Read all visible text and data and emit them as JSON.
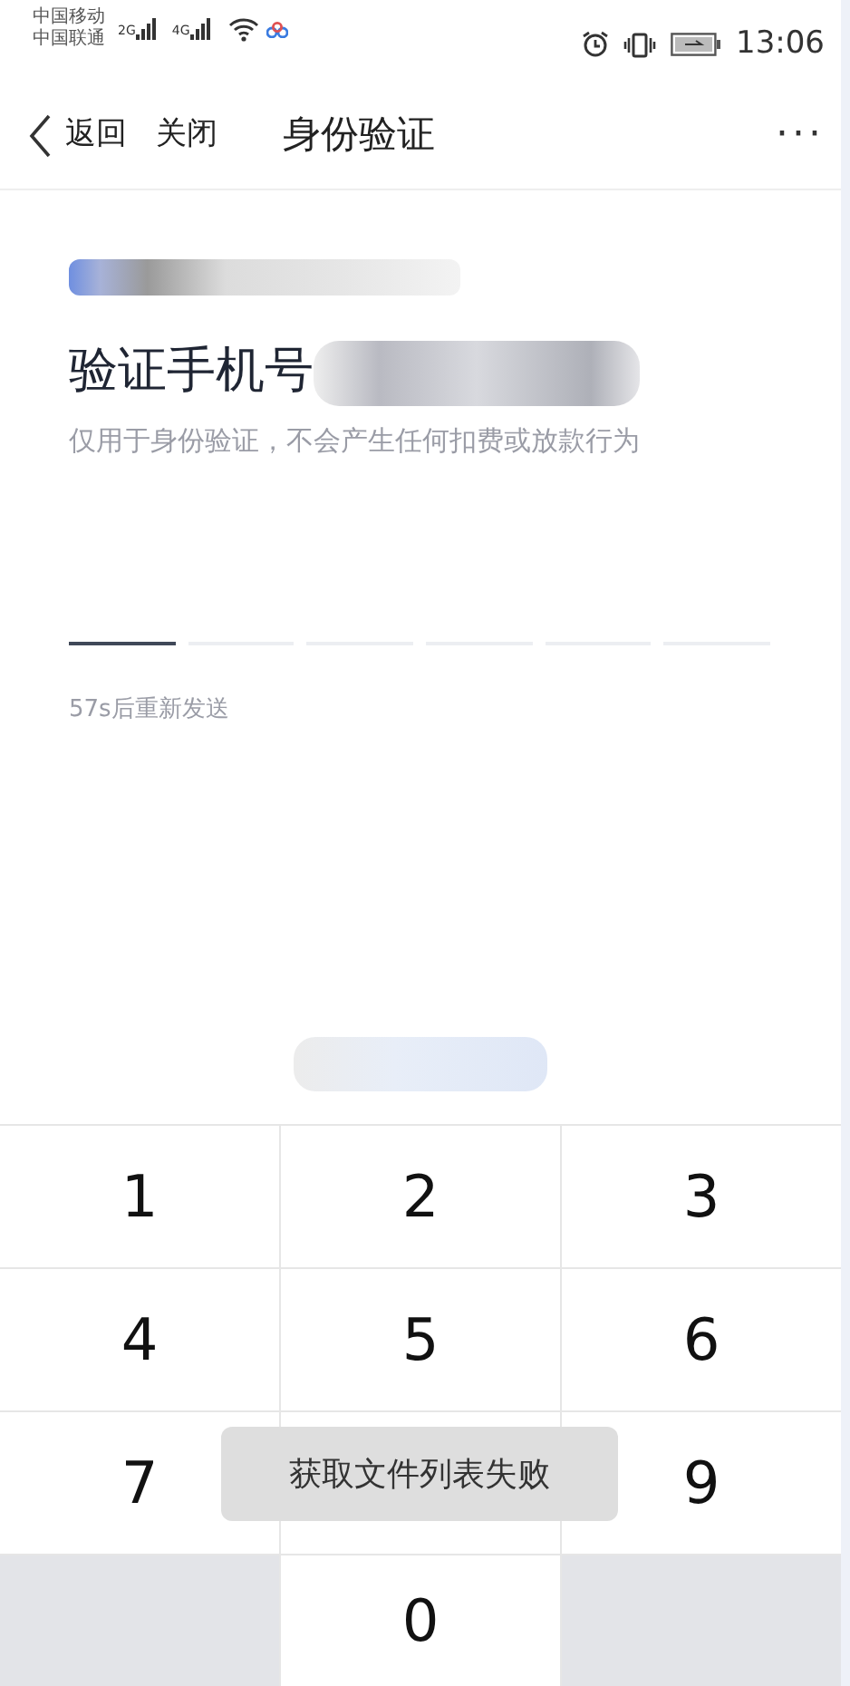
{
  "status_bar": {
    "carriers": [
      "中国移动",
      "中国联通"
    ],
    "networks": [
      "2G",
      "4G"
    ],
    "time": "13:06"
  },
  "nav": {
    "back": "返回",
    "close": "关闭",
    "title": "身份验证",
    "more": "···"
  },
  "heading": "验证手机号",
  "subtitle": "仅用于身份验证，不会产生任何扣费或放款行为",
  "code_cells": [
    {
      "selected": true
    },
    {
      "selected": false
    },
    {
      "selected": false
    },
    {
      "selected": false
    },
    {
      "selected": false
    },
    {
      "selected": false
    }
  ],
  "resend": "57s后重新发送",
  "keypad": [
    {
      "kind": "digit",
      "label": "1"
    },
    {
      "kind": "digit",
      "label": "2"
    },
    {
      "kind": "digit",
      "label": "3"
    },
    {
      "kind": "digit",
      "label": "4"
    },
    {
      "kind": "digit",
      "label": "5"
    },
    {
      "kind": "digit",
      "label": "6"
    },
    {
      "kind": "digit",
      "label": "7"
    },
    {
      "kind": "covered"
    },
    {
      "kind": "digit",
      "label": "9"
    },
    {
      "kind": "blank"
    },
    {
      "kind": "digit",
      "label": "0"
    },
    {
      "kind": "blank"
    }
  ],
  "toast": "获取文件列表失败"
}
